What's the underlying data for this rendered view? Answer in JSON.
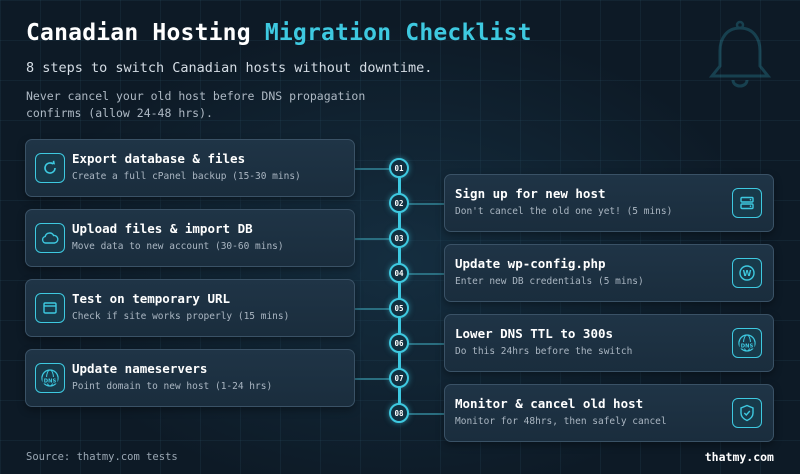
{
  "header": {
    "title_main": "Canadian Hosting ",
    "title_accent": "Migration Checklist",
    "subtitle": "8 steps to switch Canadian hosts without downtime.",
    "note": "Never cancel your old host before DNS propagation confirms (allow 24-48 hrs)."
  },
  "colors": {
    "background": "#0d1a26",
    "accent": "#3ec9e0",
    "card": "#1f3446",
    "text": "#ffffff",
    "muted": "#aab6c2"
  },
  "steps": [
    {
      "number": "01",
      "title": "Export database & files",
      "desc": "Create a full cPanel backup (15-30 mins)",
      "icon": "refresh-icon",
      "side": "left"
    },
    {
      "number": "02",
      "title": "Sign up for new host",
      "desc": "Don't cancel the old one yet! (5 mins)",
      "icon": "server-icon",
      "side": "right"
    },
    {
      "number": "03",
      "title": "Upload files & import DB",
      "desc": "Move data to new account (30-60 mins)",
      "icon": "cloud-icon",
      "side": "left"
    },
    {
      "number": "04",
      "title": "Update wp-config.php",
      "desc": "Enter new DB credentials (5 mins)",
      "icon": "wordpress-icon",
      "side": "right"
    },
    {
      "number": "05",
      "title": "Test on temporary URL",
      "desc": "Check if site works properly (15 mins)",
      "icon": "browser-window-icon",
      "side": "left"
    },
    {
      "number": "06",
      "title": "Lower DNS TTL to 300s",
      "desc": "Do this 24hrs before the switch",
      "icon": "dns-globe-icon",
      "side": "right"
    },
    {
      "number": "07",
      "title": "Update nameservers",
      "desc": "Point domain to new host (1-24 hrs)",
      "icon": "dns-globe-icon",
      "side": "left"
    },
    {
      "number": "08",
      "title": "Monitor & cancel old host",
      "desc": "Monitor for 48hrs, then safely cancel",
      "icon": "shield-check-icon",
      "side": "right"
    }
  ],
  "icon_labels": {
    "dns": "DNS",
    "wordpress": "W"
  },
  "footer": {
    "source": "Source: thatmy.com tests",
    "brand": "thatmy.com"
  }
}
